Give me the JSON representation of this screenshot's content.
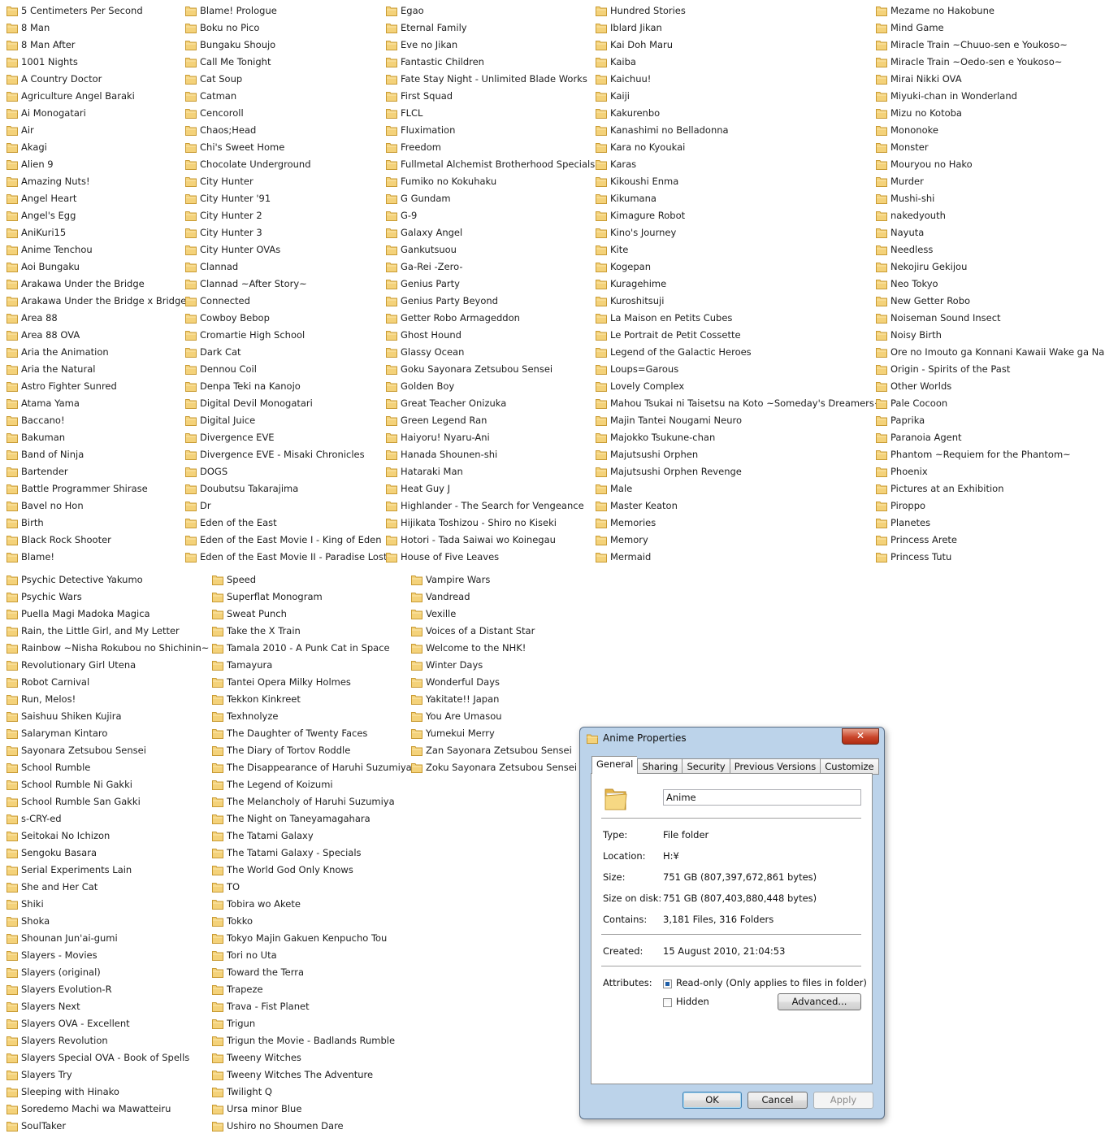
{
  "folder_columns": [
    [
      "5 Centimeters Per Second",
      "8 Man",
      "8 Man After",
      "1001 Nights",
      "A Country Doctor",
      "Agriculture Angel Baraki",
      "Ai Monogatari",
      "Air",
      "Akagi",
      "Alien 9",
      "Amazing Nuts!",
      "Angel Heart",
      "Angel's Egg",
      "AniKuri15",
      "Anime Tenchou",
      "Aoi Bungaku",
      "Arakawa Under the Bridge",
      "Arakawa Under the Bridge x Bridge",
      "Area 88",
      "Area 88 OVA",
      "Aria the Animation",
      "Aria the Natural",
      "Astro Fighter Sunred",
      "Atama Yama",
      "Baccano!",
      "Bakuman",
      "Band of Ninja",
      "Bartender",
      "Battle Programmer Shirase",
      "Bavel no Hon",
      "Birth",
      "Black Rock Shooter",
      "Blame!"
    ],
    [
      "Blame! Prologue",
      "Boku no Pico",
      "Bungaku Shoujo",
      "Call Me Tonight",
      "Cat Soup",
      "Catman",
      "Cencoroll",
      "Chaos;Head",
      "Chi's Sweet Home",
      "Chocolate Underground",
      "City Hunter",
      "City Hunter '91",
      "City Hunter 2",
      "City Hunter 3",
      "City Hunter OVAs",
      "Clannad",
      "Clannad ~After Story~",
      "Connected",
      "Cowboy Bebop",
      "Cromartie High School",
      "Dark Cat",
      "Dennou Coil",
      "Denpa Teki na Kanojo",
      "Digital Devil Monogatari",
      "Digital Juice",
      "Divergence EVE",
      "Divergence EVE - Misaki Chronicles",
      "DOGS",
      "Doubutsu Takarajima",
      "Dr",
      "Eden of the East",
      "Eden of the East Movie I - King of Eden",
      "Eden of the East Movie II - Paradise Lost"
    ],
    [
      "Egao",
      "Eternal Family",
      "Eve no Jikan",
      "Fantastic Children",
      "Fate Stay Night - Unlimited Blade Works",
      "First Squad",
      "FLCL",
      "Fluximation",
      "Freedom",
      "Fullmetal Alchemist Brotherhood Specials",
      "Fumiko no Kokuhaku",
      "G Gundam",
      "G-9",
      "Galaxy Angel",
      "Gankutsuou",
      "Ga-Rei -Zero-",
      "Genius Party",
      "Genius Party Beyond",
      "Getter Robo Armageddon",
      "Ghost Hound",
      "Glassy Ocean",
      "Goku Sayonara Zetsubou Sensei",
      "Golden Boy",
      "Great Teacher Onizuka",
      "Green Legend Ran",
      "Haiyoru! Nyaru-Ani",
      "Hanada Shounen-shi",
      "Hataraki Man",
      "Heat Guy J",
      "Highlander - The Search for Vengeance",
      "Hijikata Toshizou - Shiro no Kiseki",
      "Hotori - Tada Saiwai wo Koinegau",
      "House of Five Leaves"
    ],
    [
      "Hundred Stories",
      "Iblard Jikan",
      "Kai Doh Maru",
      "Kaiba",
      "Kaichuu!",
      "Kaiji",
      "Kakurenbo",
      "Kanashimi no Belladonna",
      "Kara no Kyoukai",
      "Karas",
      "Kikoushi Enma",
      "Kikumana",
      "Kimagure Robot",
      "Kino's Journey",
      "Kite",
      "Kogepan",
      "Kuragehime",
      "Kuroshitsuji",
      "La Maison en Petits Cubes",
      "Le Portrait de Petit Cossette",
      "Legend of the Galactic Heroes",
      "Loups=Garous",
      "Lovely Complex",
      "Mahou Tsukai ni Taisetsu na Koto ~Someday's Dreamers~",
      "Majin Tantei Nougami Neuro",
      "Majokko Tsukune-chan",
      "Majutsushi Orphen",
      "Majutsushi Orphen Revenge",
      "Male",
      "Master Keaton",
      "Memories",
      "Memory",
      "Mermaid"
    ],
    [
      "Mezame no Hakobune",
      "Mind Game",
      "Miracle Train ~Chuuo-sen e Youkoso~",
      "Miracle Train ~Oedo-sen e Youkoso~",
      "Mirai Nikki OVA",
      "Miyuki-chan in Wonderland",
      "Mizu no Kotoba",
      "Mononoke",
      "Monster",
      "Mouryou no Hako",
      "Murder",
      "Mushi-shi",
      "nakedyouth",
      "Nayuta",
      "Needless",
      "Nekojiru Gekijou",
      "Neo Tokyo",
      "New Getter Robo",
      "Noiseman Sound Insect",
      "Noisy Birth",
      "Ore no Imouto ga Konnani Kawaii Wake ga Nai",
      "Origin - Spirits of the Past",
      "Other Worlds",
      "Pale Cocoon",
      "Paprika",
      "Paranoia Agent",
      "Phantom ~Requiem for the Phantom~",
      "Phoenix",
      "Pictures at an Exhibition",
      "Piroppo",
      "Planetes",
      "Princess Arete",
      "Princess Tutu"
    ],
    [
      "Psychic Detective Yakumo",
      "Psychic Wars",
      "Puella Magi Madoka Magica",
      "Rain, the Little Girl, and My Letter",
      "Rainbow ~Nisha Rokubou no Shichinin~",
      "Revolutionary Girl Utena",
      "Robot Carnival",
      "Run, Melos!",
      "Saishuu Shiken Kujira",
      "Salaryman Kintaro",
      "Sayonara Zetsubou Sensei",
      "School Rumble",
      "School Rumble Ni Gakki",
      "School Rumble San Gakki",
      "s-CRY-ed",
      "Seitokai No Ichizon",
      "Sengoku Basara",
      "Serial Experiments Lain",
      "She and Her Cat",
      "Shiki",
      "Shoka",
      "Shounan Jun'ai-gumi",
      "Slayers - Movies",
      "Slayers (original)",
      "Slayers Evolution-R",
      "Slayers Next",
      "Slayers OVA - Excellent",
      "Slayers Revolution",
      "Slayers Special OVA - Book of Spells",
      "Slayers Try",
      "Sleeping with Hinako",
      "Soredemo Machi wa Mawatteiru",
      "SoulTaker"
    ],
    [
      "Speed",
      "Superflat Monogram",
      "Sweat Punch",
      "Take the X Train",
      "Tamala 2010 - A Punk Cat in Space",
      "Tamayura",
      "Tantei Opera Milky Holmes",
      "Tekkon Kinkreet",
      "Texhnolyze",
      "The Daughter of Twenty Faces",
      "The Diary of Tortov Roddle",
      "The Disappearance of Haruhi Suzumiya",
      "The Legend of Koizumi",
      "The Melancholy of Haruhi Suzumiya",
      "The Night on Taneyamagahara",
      "The Tatami Galaxy",
      "The Tatami Galaxy - Specials",
      "The World God Only Knows",
      "TO",
      "Tobira wo Akete",
      "Tokko",
      "Tokyo Majin Gakuen Kenpucho Tou",
      "Tori no Uta",
      "Toward the Terra",
      "Trapeze",
      "Trava - Fist Planet",
      "Trigun",
      "Trigun the Movie - Badlands Rumble",
      "Tweeny Witches",
      "Tweeny Witches The Adventure",
      "Twilight Q",
      "Ursa minor Blue",
      "Ushiro no Shoumen Dare"
    ],
    [
      "Vampire Wars",
      "Vandread",
      "Vexille",
      "Voices of a Distant Star",
      "Welcome to the NHK!",
      "Winter Days",
      "Wonderful Days",
      "Yakitate!! Japan",
      "You Are Umasou",
      "Yumekui Merry",
      "Zan Sayonara Zetsubou Sensei",
      "Zoku Sayonara Zetsubou Sensei"
    ]
  ],
  "dialog": {
    "title": "Anime Properties",
    "close_glyph": "✕",
    "tabs": [
      "General",
      "Sharing",
      "Security",
      "Previous Versions",
      "Customize"
    ],
    "folder_name": "Anime",
    "type_label": "Type:",
    "type_value": "File folder",
    "location_label": "Location:",
    "location_value": "H:¥",
    "size_label": "Size:",
    "size_value": "751 GB (807,397,672,861 bytes)",
    "size_on_disk_label": "Size on disk:",
    "size_on_disk_value": "751 GB (807,403,880,448 bytes)",
    "contains_label": "Contains:",
    "contains_value": "3,181 Files, 316 Folders",
    "created_label": "Created:",
    "created_value": "15 August 2010, 21:04:53",
    "attributes_label": "Attributes:",
    "readonly_label": "Read-only (Only applies to files in folder)",
    "readonly_checked": true,
    "hidden_label": "Hidden",
    "hidden_checked": false,
    "advanced_label": "Advanced...",
    "ok_label": "OK",
    "cancel_label": "Cancel",
    "apply_label": "Apply"
  },
  "colors": {
    "folder_fill": "#f4d27a",
    "folder_dark": "#d9a93c",
    "dialog_frame": "#bcd3ea",
    "close_red": "#c9452a"
  }
}
